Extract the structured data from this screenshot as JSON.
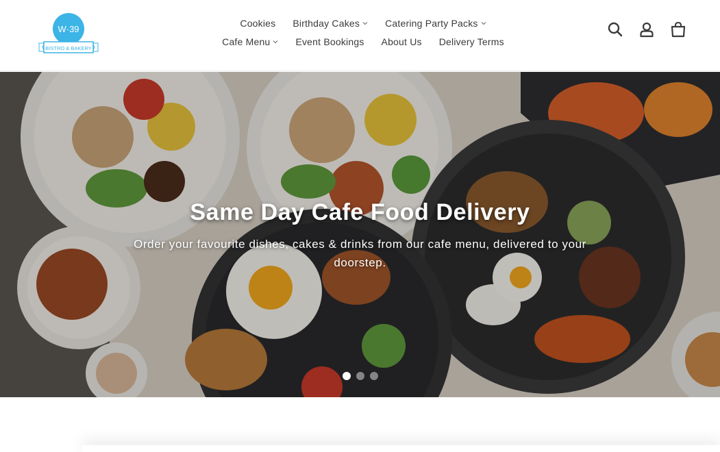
{
  "brand": {
    "logo_text_top": "W·39",
    "logo_text_ribbon": "BISTRO & BAKERY",
    "accent": "#3cb4e6"
  },
  "nav": {
    "row1": [
      {
        "label": "Cookies",
        "dropdown": false
      },
      {
        "label": "Birthday Cakes",
        "dropdown": true
      },
      {
        "label": "Catering Party Packs",
        "dropdown": true
      }
    ],
    "row2": [
      {
        "label": "Cafe Menu",
        "dropdown": true
      },
      {
        "label": "Event Bookings",
        "dropdown": false
      },
      {
        "label": "About Us",
        "dropdown": false
      },
      {
        "label": "Delivery Terms",
        "dropdown": false
      }
    ]
  },
  "header_icons": [
    "search-icon",
    "account-icon",
    "cart-icon"
  ],
  "hero": {
    "title": "Same Day Cafe Food Delivery",
    "subtitle": "Order your favourite dishes, cakes & drinks from our cafe menu, delivered to your doorstep.",
    "slides_total": 3,
    "active_slide": 1
  }
}
